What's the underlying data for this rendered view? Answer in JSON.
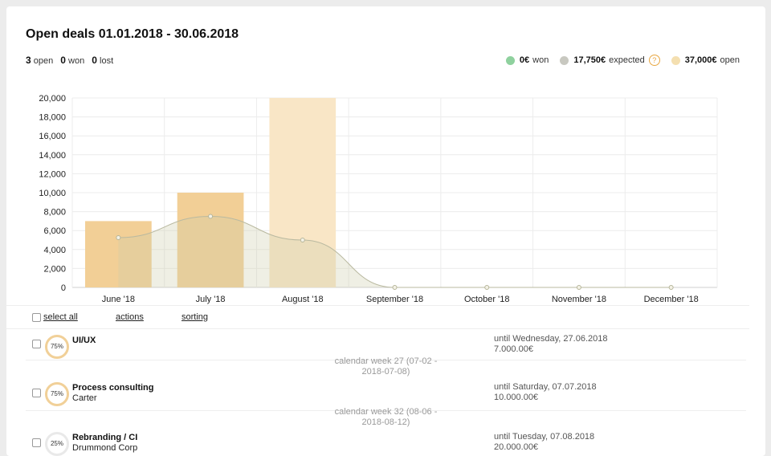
{
  "title": "Open deals 01.01.2018 - 30.06.2018",
  "counts": {
    "open_num": "3",
    "open_label": "open",
    "won_num": "0",
    "won_label": "won",
    "lost_num": "0",
    "lost_label": "lost"
  },
  "legend": {
    "won_value": "0€",
    "won_label": "won",
    "expected_value": "17,750€",
    "expected_label": "expected",
    "help_glyph": "?",
    "open_value": "37,000€",
    "open_label": "open",
    "colors": {
      "won": "#8fd19e",
      "expected": "#c8c8c0",
      "open": "#f4dfb0"
    }
  },
  "chart_data": {
    "type": "bar",
    "categories": [
      "June '18",
      "July '18",
      "August '18",
      "September '18",
      "October '18",
      "November '18",
      "December '18"
    ],
    "series": [
      {
        "name": "open",
        "type": "bar",
        "values": [
          7000,
          10000,
          20000,
          0,
          0,
          0,
          0
        ],
        "colors": [
          "#f2cf96",
          "#f2cf96",
          "#f9e6c6",
          "#f2cf96",
          "#f2cf96",
          "#f2cf96",
          "#f2cf96"
        ]
      },
      {
        "name": "expected",
        "type": "area",
        "values": [
          5250,
          7500,
          5000,
          0,
          0,
          0,
          0
        ],
        "color": "#c8c8a8"
      }
    ],
    "yticks": [
      0,
      2000,
      4000,
      6000,
      8000,
      10000,
      12000,
      14000,
      16000,
      18000,
      20000
    ],
    "ytick_labels": [
      "0",
      "2,000",
      "4,000",
      "6,000",
      "8,000",
      "10,000",
      "12,000",
      "14,000",
      "16,000",
      "18,000",
      "20,000"
    ],
    "ylim": [
      0,
      20000
    ],
    "grid": true
  },
  "toolbar": {
    "select_all": "select all",
    "actions": "actions",
    "sorting": "sorting"
  },
  "deals": [
    {
      "prob": "75%",
      "name": "UI/UX",
      "company": "",
      "until": "until Wednesday, 27.06.2018",
      "value": "7.000.00€"
    },
    {
      "prob": "75%",
      "name": "Process consulting",
      "company": "Carter",
      "until": "until Saturday, 07.07.2018",
      "value": "10.000.00€"
    },
    {
      "prob": "25%",
      "name": "Rebranding / CI",
      "company": "Drummond Corp",
      "until": "until Tuesday, 07.08.2018",
      "value": "20.000.00€"
    }
  ],
  "weeks": [
    {
      "line1": "calendar week 27 (07-02 -",
      "line2": "2018-07-08)"
    },
    {
      "line1": "calendar week 32 (08-06 -",
      "line2": "2018-08-12)"
    }
  ]
}
